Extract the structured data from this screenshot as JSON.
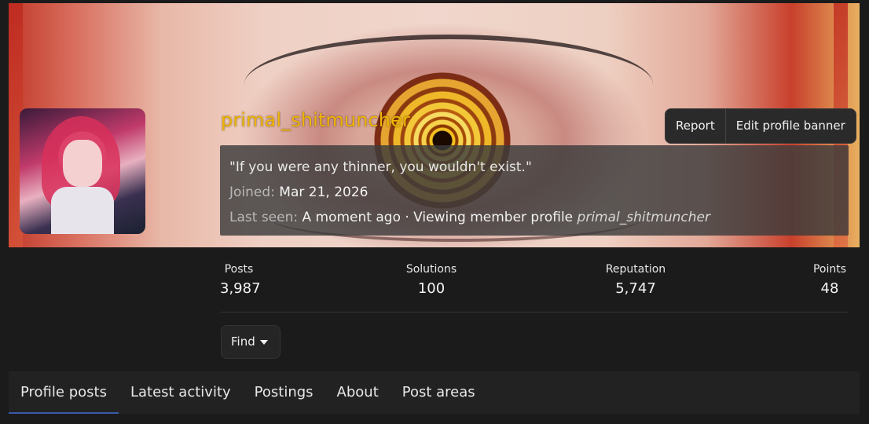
{
  "profile": {
    "username": "primal_shitmuncher",
    "status_quote": "\"If you were any thinner, you wouldn't exist.\"",
    "joined_label": "Joined:",
    "joined_value": "Mar 21, 2026",
    "last_seen_label": "Last seen:",
    "last_seen_value": "A moment ago · Viewing member profile",
    "last_seen_target": "primal_shitmuncher"
  },
  "actions": {
    "report_label": "Report",
    "edit_banner_label": "Edit profile banner",
    "find_label": "Find"
  },
  "stats": [
    {
      "label": "Posts",
      "value": "3,987"
    },
    {
      "label": "Solutions",
      "value": "100"
    },
    {
      "label": "Reputation",
      "value": "5,747"
    },
    {
      "label": "Points",
      "value": "48"
    }
  ],
  "tabs": [
    {
      "label": "Profile posts",
      "active": true
    },
    {
      "label": "Latest activity",
      "active": false
    },
    {
      "label": "Postings",
      "active": false
    },
    {
      "label": "About",
      "active": false
    },
    {
      "label": "Post areas",
      "active": false
    }
  ],
  "colors": {
    "username": "#f0b400",
    "background": "#1b1b1b",
    "active_tab_underline": "#3a5aa8"
  }
}
